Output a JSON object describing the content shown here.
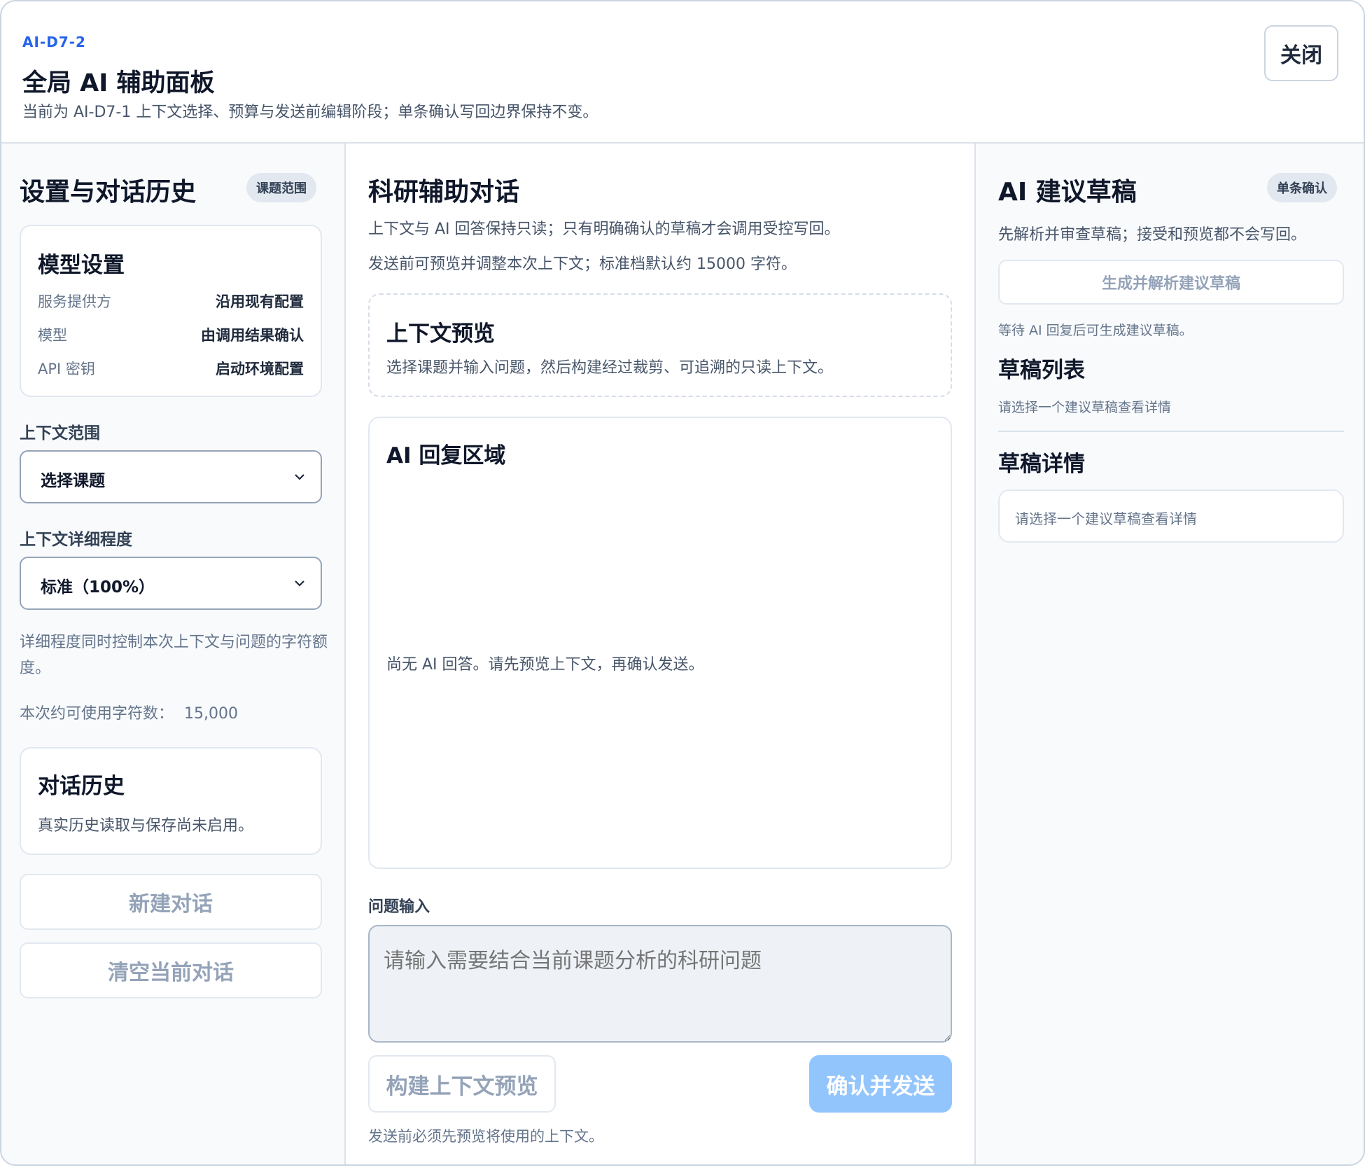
{
  "header": {
    "code": "AI-D7-2",
    "title": "全局 AI 辅助面板",
    "subtitle": "当前为 AI-D7-1 上下文选择、预算与发送前编辑阶段；单条确认写回边界保持不变。",
    "close_label": "关闭"
  },
  "left": {
    "title": "设置与对话历史",
    "badge": "课题范围",
    "model_settings": {
      "title": "模型设置",
      "rows": [
        {
          "label": "服务提供方",
          "value": "沿用现有配置"
        },
        {
          "label": "模型",
          "value": "由调用结果确认"
        },
        {
          "label": "API 密钥",
          "value": "启动环境配置"
        }
      ]
    },
    "context_scope": {
      "label": "上下文范围",
      "selected": "选择课题"
    },
    "detail_level": {
      "label": "上下文详细程度",
      "selected": "标准（100%）"
    },
    "detail_note": "详细程度同时控制本次上下文与问题的字符额度。",
    "char_budget_label": "本次约可使用字符数：",
    "char_budget_value": "15,000",
    "history": {
      "title": "对话历史",
      "note": "真实历史读取与保存尚未启用。"
    },
    "new_chat_label": "新建对话",
    "clear_chat_label": "清空当前对话"
  },
  "middle": {
    "title": "科研辅助对话",
    "desc1": "上下文与 AI 回答保持只读；只有明确确认的草稿才会调用受控写回。",
    "desc2": "发送前可预览并调整本次上下文；标准档默认约 15000 字符。",
    "context_preview": {
      "title": "上下文预览",
      "desc": "选择课题并输入问题，然后构建经过裁剪、可追溯的只读上下文。"
    },
    "reply": {
      "title": "AI 回复区域",
      "empty": "尚无 AI 回答。请先预览上下文，再确认发送。"
    },
    "question": {
      "label": "问题输入",
      "placeholder": "请输入需要结合当前课题分析的科研问题"
    },
    "build_preview_label": "构建上下文预览",
    "send_label": "确认并发送",
    "footer_note": "发送前必须先预览将使用的上下文。"
  },
  "right": {
    "title": "AI 建议草稿",
    "badge": "单条确认",
    "desc": "先解析并审查草稿；接受和预览都不会写回。",
    "generate_label": "生成并解析建议草稿",
    "wait_note": "等待 AI 回复后可生成建议草稿。",
    "list": {
      "title": "草稿列表",
      "empty": "请选择一个建议草稿查看详情"
    },
    "detail": {
      "title": "草稿详情",
      "empty": "请选择一个建议草稿查看详情"
    }
  },
  "colors": {
    "accent": "#2563eb",
    "primary_disabled": "#93c5fd",
    "border": "#e2e8f0",
    "muted_text": "#64748b"
  }
}
